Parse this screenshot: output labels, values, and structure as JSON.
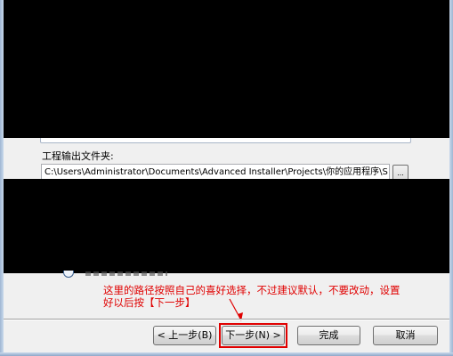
{
  "output_folder": {
    "label": "工程输出文件夹:",
    "path_value": "C:\\Users\\Administrator\\Documents\\Advanced Installer\\Projects\\你的应用程序\\S",
    "browse_label": "..."
  },
  "annotation": {
    "line1": "这里的路径按照自己的喜好选择，不过建议默认，不要改动，设置",
    "line2": "好以后按【下一步】"
  },
  "buttons": {
    "back": "< 上一步(B)",
    "next": "下一步(N) >",
    "finish": "完成",
    "cancel": "取消"
  },
  "colors": {
    "annotation": "#e00000",
    "highlight": "#e00000",
    "redaction": "#000000",
    "dialog_bg": "#f0f0f0"
  }
}
